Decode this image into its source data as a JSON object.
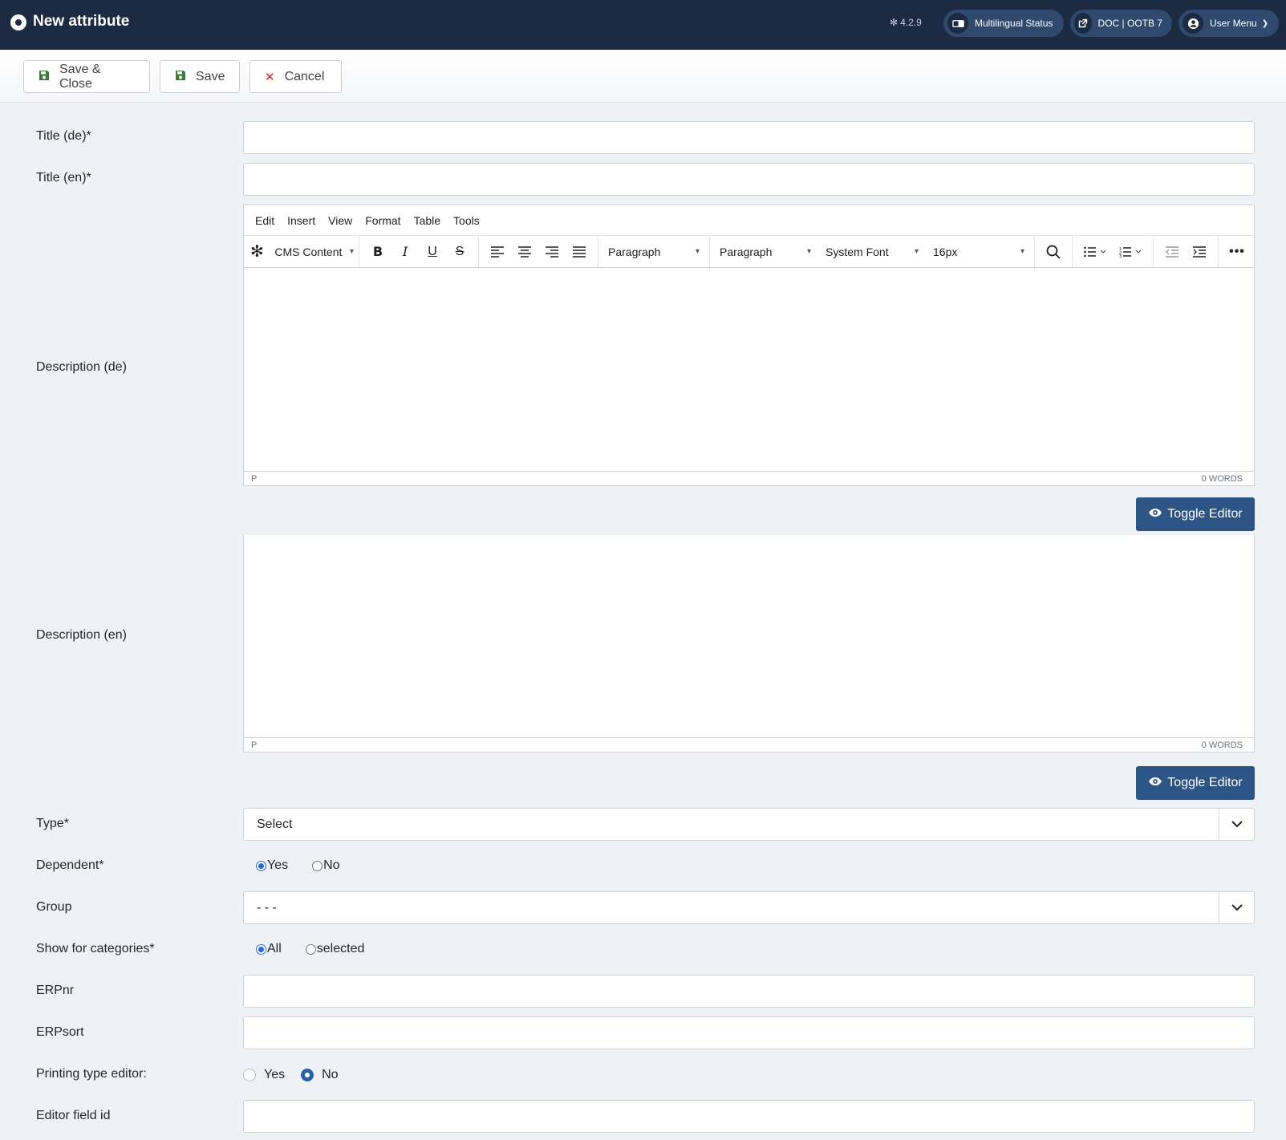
{
  "header": {
    "title": "New attribute",
    "version": "4.2.9",
    "multilingual_label": "Multilingual Status",
    "doc_label": "DOC | OOTB 7",
    "user_menu_label": "User Menu"
  },
  "toolbar": {
    "save_close_label": "Save & Close",
    "save_label": "Save",
    "cancel_label": "Cancel"
  },
  "form": {
    "title_de_label": "Title (de)*",
    "title_de_value": "",
    "title_en_label": "Title (en)*",
    "title_en_value": "",
    "description_de_label": "Description (de)",
    "description_en_label": "Description (en)",
    "type_label": "Type*",
    "type_value": "Select",
    "dependent_label": "Dependent*",
    "dependent_yes": "Yes",
    "dependent_no": "No",
    "dependent_selected": "Yes",
    "group_label": "Group",
    "group_value": "- - -",
    "categories_label": "Show for categories*",
    "categories_all": "All",
    "categories_selected": "selected",
    "categories_choice": "All",
    "erpnr_label": "ERPnr",
    "erpnr_value": "",
    "erpsort_label": "ERPsort",
    "erpsort_value": "",
    "printing_label": "Printing type editor:",
    "printing_yes": "Yes",
    "printing_no": "No",
    "printing_selected": "No",
    "editor_field_label": "Editor field id",
    "editor_field_value": ""
  },
  "editor": {
    "menu": [
      "Edit",
      "Insert",
      "View",
      "Format",
      "Table",
      "Tools"
    ],
    "cms_content": "CMS Content",
    "block_format": "Paragraph",
    "style_format": "Paragraph",
    "font_family": "System Font",
    "font_size": "16px",
    "status_path": "P",
    "word_count": "0 WORDS",
    "toggle_label": "Toggle Editor"
  },
  "colors": {
    "header_bg": "#1c2b41",
    "pill_bg": "#2f4a6e",
    "primary": "#2c5586",
    "page_bg": "#eef2f7",
    "cancel_red": "#c52827",
    "save_green": "#3a7a3a"
  }
}
